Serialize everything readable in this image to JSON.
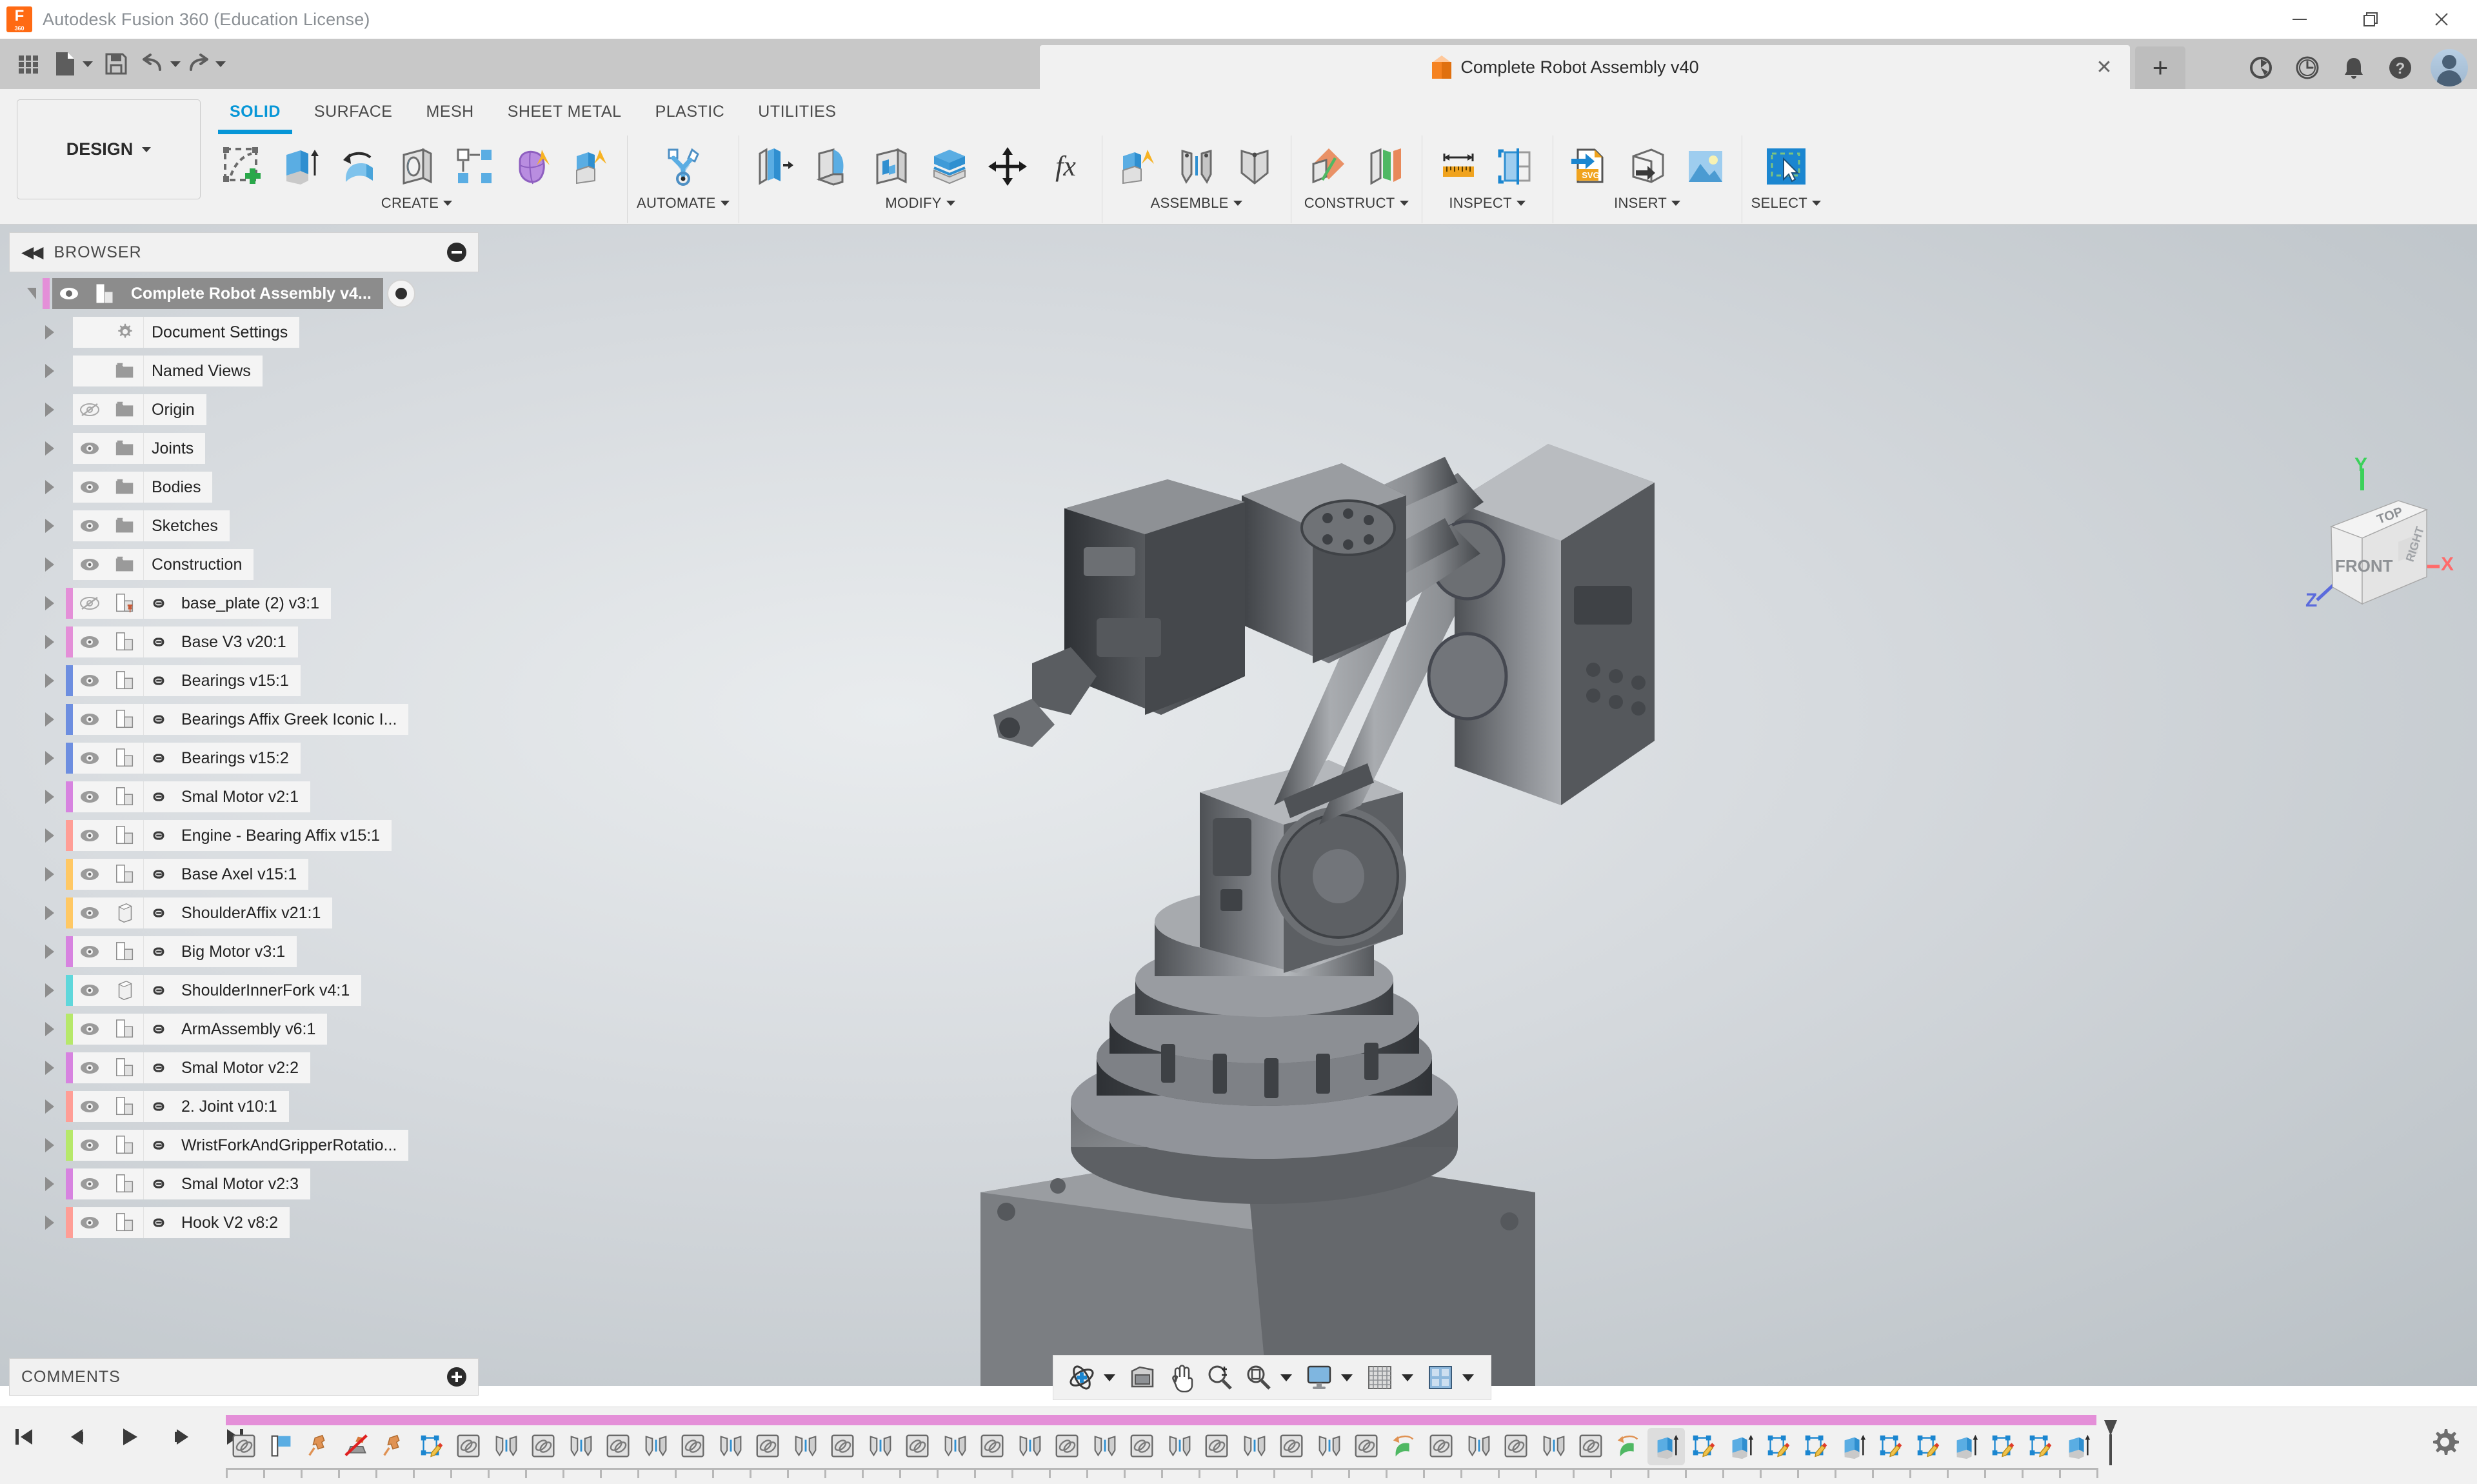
{
  "app": {
    "title": "Autodesk Fusion 360 (Education License)",
    "logo_letter": "F",
    "logo_sub": "360"
  },
  "window_controls": {
    "minimize": "—",
    "maximize": "restore-icon",
    "close": "✕"
  },
  "quick_access": [
    {
      "name": "show-data-panel",
      "icon": "grid-icon",
      "caret": false
    },
    {
      "name": "file-menu",
      "icon": "file-icon",
      "caret": true
    },
    {
      "name": "save",
      "icon": "save-icon",
      "caret": false
    },
    {
      "name": "undo",
      "icon": "undo-icon",
      "caret": true
    },
    {
      "name": "redo",
      "icon": "redo-icon",
      "caret": true
    }
  ],
  "document_tab": {
    "title": "Complete Robot Assembly v40",
    "close_label": "✕",
    "new_tab_label": "+"
  },
  "tab_icons": [
    {
      "name": "extensions-icon"
    },
    {
      "name": "recent-icon"
    },
    {
      "name": "notifications-icon"
    },
    {
      "name": "help-icon"
    },
    {
      "name": "account-avatar"
    }
  ],
  "workspace": {
    "selector_label": "DESIGN"
  },
  "ribbon": {
    "tabs": [
      {
        "label": "SOLID",
        "active": true
      },
      {
        "label": "SURFACE",
        "active": false
      },
      {
        "label": "MESH",
        "active": false
      },
      {
        "label": "SHEET METAL",
        "active": false
      },
      {
        "label": "PLASTIC",
        "active": false
      },
      {
        "label": "UTILITIES",
        "active": false
      }
    ],
    "panels": [
      {
        "label": "CREATE",
        "dropdown": true,
        "tools": [
          {
            "name": "create-sketch-icon"
          },
          {
            "name": "extrude-icon"
          },
          {
            "name": "revolve-icon"
          },
          {
            "name": "hole-icon"
          },
          {
            "name": "pattern-icon"
          },
          {
            "name": "form-icon"
          },
          {
            "name": "derive-icon"
          }
        ]
      },
      {
        "label": "AUTOMATE",
        "dropdown": true,
        "tools": [
          {
            "name": "automated-modeling-icon"
          }
        ]
      },
      {
        "label": "MODIFY",
        "dropdown": true,
        "tools": [
          {
            "name": "press-pull-icon"
          },
          {
            "name": "fillet-icon"
          },
          {
            "name": "shell-icon"
          },
          {
            "name": "offset-face-icon"
          },
          {
            "name": "move-copy-icon"
          },
          {
            "name": "change-parameters-icon"
          }
        ]
      },
      {
        "label": "ASSEMBLE",
        "dropdown": true,
        "tools": [
          {
            "name": "new-component-icon"
          },
          {
            "name": "joint-icon"
          },
          {
            "name": "as-built-joint-icon"
          }
        ]
      },
      {
        "label": "CONSTRUCT",
        "dropdown": true,
        "tools": [
          {
            "name": "offset-plane-icon"
          },
          {
            "name": "plane-at-angle-icon"
          }
        ]
      },
      {
        "label": "INSPECT",
        "dropdown": true,
        "tools": [
          {
            "name": "measure-icon"
          },
          {
            "name": "section-analysis-icon"
          }
        ]
      },
      {
        "label": "INSERT",
        "dropdown": true,
        "tools": [
          {
            "name": "insert-svg-icon"
          },
          {
            "name": "insert-mcmaster-icon"
          },
          {
            "name": "canvas-image-icon"
          }
        ]
      },
      {
        "label": "SELECT",
        "dropdown": true,
        "tools": [
          {
            "name": "select-window-icon"
          }
        ]
      }
    ]
  },
  "browser": {
    "header": "BROWSER",
    "collapse_icon": "double-chevron-left-icon",
    "toggle_icon": "minus-circle-icon",
    "root": {
      "label": "Complete Robot Assembly v4...",
      "icon": "component-icon",
      "visible": true,
      "selected": true,
      "color": "#e48fd8"
    },
    "items": [
      {
        "label": "Document Settings",
        "icon": "gear-icon",
        "eye": "none",
        "link": false,
        "color": null
      },
      {
        "label": "Named Views",
        "icon": "folder-icon",
        "eye": "none",
        "link": false,
        "color": null
      },
      {
        "label": "Origin",
        "icon": "folder-icon",
        "eye": "hidden",
        "link": false,
        "color": null
      },
      {
        "label": "Joints",
        "icon": "folder-icon",
        "eye": "visible",
        "link": false,
        "color": null
      },
      {
        "label": "Bodies",
        "icon": "folder-icon",
        "eye": "visible",
        "link": false,
        "color": null
      },
      {
        "label": "Sketches",
        "icon": "folder-icon",
        "eye": "visible",
        "link": false,
        "color": null
      },
      {
        "label": "Construction",
        "icon": "folder-icon",
        "eye": "visible",
        "link": false,
        "color": null
      },
      {
        "label": "base_plate (2) v3:1",
        "icon": "component-pinned-icon",
        "eye": "hidden",
        "link": true,
        "color": "#e48fd8"
      },
      {
        "label": "Base V3 v20:1",
        "icon": "component-icon",
        "eye": "visible",
        "link": true,
        "color": "#e48fd8"
      },
      {
        "label": "Bearings v15:1",
        "icon": "component-icon",
        "eye": "visible",
        "link": true,
        "color": "#6d8ee0"
      },
      {
        "label": "Bearings Affix Greek Iconic I...",
        "icon": "component-icon",
        "eye": "visible",
        "link": true,
        "color": "#6d8ee0"
      },
      {
        "label": "Bearings v15:2",
        "icon": "component-icon",
        "eye": "visible",
        "link": true,
        "color": "#6d8ee0"
      },
      {
        "label": "Smal Motor v2:1",
        "icon": "component-icon",
        "eye": "visible",
        "link": true,
        "color": "#d783e0"
      },
      {
        "label": "Engine - Bearing Affix v15:1",
        "icon": "component-icon",
        "eye": "visible",
        "link": true,
        "color": "#ff9e96"
      },
      {
        "label": "Base Axel v15:1",
        "icon": "component-icon",
        "eye": "visible",
        "link": true,
        "color": "#ffc864"
      },
      {
        "label": "ShoulderAffix v21:1",
        "icon": "body-icon",
        "eye": "visible",
        "link": true,
        "color": "#ffc864"
      },
      {
        "label": "Big Motor v3:1",
        "icon": "component-icon",
        "eye": "visible",
        "link": true,
        "color": "#d783e0"
      },
      {
        "label": "ShoulderInnerFork v4:1",
        "icon": "body-icon",
        "eye": "visible",
        "link": true,
        "color": "#5fd7db"
      },
      {
        "label": "ArmAssembly v6:1",
        "icon": "component-icon",
        "eye": "visible",
        "link": true,
        "color": "#b6e86a"
      },
      {
        "label": "Smal Motor v2:2",
        "icon": "component-icon",
        "eye": "visible",
        "link": true,
        "color": "#d783e0"
      },
      {
        "label": "2. Joint v10:1",
        "icon": "component-icon",
        "eye": "visible",
        "link": true,
        "color": "#ff9e96"
      },
      {
        "label": "WristForkAndGripperRotatio...",
        "icon": "component-icon",
        "eye": "visible",
        "link": true,
        "color": "#b6e86a"
      },
      {
        "label": "Smal Motor v2:3",
        "icon": "component-icon",
        "eye": "visible",
        "link": true,
        "color": "#d783e0"
      },
      {
        "label": "Hook V2 v8:2",
        "icon": "component-icon",
        "eye": "visible",
        "link": true,
        "color": "#ff9e96"
      }
    ]
  },
  "comments": {
    "header": "COMMENTS",
    "add_icon": "plus-circle-icon"
  },
  "view_cube": {
    "top_face": "TOP",
    "front_face": "FRONT",
    "right_face": "RIGHT",
    "axis_x": "X",
    "axis_y": "Y",
    "axis_z": "Z",
    "color_x": "#ff6b6b",
    "color_y": "#3bd15a",
    "color_z": "#5b6bdc"
  },
  "nav_bar": [
    {
      "name": "orbit-icon",
      "caret": true
    },
    {
      "name": "look-at-icon",
      "caret": false
    },
    {
      "name": "pan-icon",
      "caret": false
    },
    {
      "name": "zoom-icon",
      "caret": false
    },
    {
      "name": "fit-icon",
      "caret": true
    },
    {
      "name": "display-settings-icon",
      "caret": true
    },
    {
      "name": "grid-snap-icon",
      "caret": true
    },
    {
      "name": "viewports-icon",
      "caret": true
    }
  ],
  "timeline": {
    "playback": [
      {
        "name": "go-to-beginning-button",
        "icon": "skip-start-icon"
      },
      {
        "name": "step-back-button",
        "icon": "step-back-icon"
      },
      {
        "name": "play-button",
        "icon": "play-icon"
      },
      {
        "name": "step-forward-button",
        "icon": "step-forward-icon"
      },
      {
        "name": "go-to-end-button",
        "icon": "skip-end-icon"
      }
    ],
    "group_bar_color": "#e48fd8",
    "settings_icon": "gear-icon",
    "features": [
      {
        "type": "joint",
        "selected": false
      },
      {
        "type": "flag",
        "selected": false
      },
      {
        "type": "pin",
        "selected": false
      },
      {
        "type": "ground-off",
        "selected": false
      },
      {
        "type": "pin",
        "selected": false
      },
      {
        "type": "sketch",
        "selected": false
      },
      {
        "type": "joint",
        "selected": false
      },
      {
        "type": "rigid",
        "selected": false
      },
      {
        "type": "joint",
        "selected": false
      },
      {
        "type": "rigid",
        "selected": false
      },
      {
        "type": "joint",
        "selected": false
      },
      {
        "type": "rigid",
        "selected": false
      },
      {
        "type": "joint",
        "selected": false
      },
      {
        "type": "rigid",
        "selected": false
      },
      {
        "type": "joint",
        "selected": false
      },
      {
        "type": "rigid",
        "selected": false
      },
      {
        "type": "joint",
        "selected": false
      },
      {
        "type": "rigid",
        "selected": false
      },
      {
        "type": "joint",
        "selected": false
      },
      {
        "type": "rigid",
        "selected": false
      },
      {
        "type": "joint",
        "selected": false
      },
      {
        "type": "rigid",
        "selected": false
      },
      {
        "type": "joint",
        "selected": false
      },
      {
        "type": "rigid",
        "selected": false
      },
      {
        "type": "joint",
        "selected": false
      },
      {
        "type": "rigid",
        "selected": false
      },
      {
        "type": "joint",
        "selected": false
      },
      {
        "type": "rigid",
        "selected": false
      },
      {
        "type": "joint",
        "selected": false
      },
      {
        "type": "rigid",
        "selected": false
      },
      {
        "type": "joint",
        "selected": false
      },
      {
        "type": "revolve",
        "selected": false
      },
      {
        "type": "joint",
        "selected": false
      },
      {
        "type": "rigid",
        "selected": false
      },
      {
        "type": "joint",
        "selected": false
      },
      {
        "type": "rigid",
        "selected": false
      },
      {
        "type": "joint",
        "selected": false
      },
      {
        "type": "revolve",
        "selected": false
      },
      {
        "type": "extrude",
        "selected": true
      },
      {
        "type": "sketch",
        "selected": false
      },
      {
        "type": "extrude",
        "selected": false
      },
      {
        "type": "sketch",
        "selected": false
      },
      {
        "type": "sketch",
        "selected": false
      },
      {
        "type": "extrude",
        "selected": false
      },
      {
        "type": "sketch",
        "selected": false
      },
      {
        "type": "sketch",
        "selected": false
      },
      {
        "type": "extrude",
        "selected": false
      },
      {
        "type": "sketch",
        "selected": false
      },
      {
        "type": "sketch",
        "selected": false
      },
      {
        "type": "extrude",
        "selected": false
      }
    ]
  }
}
